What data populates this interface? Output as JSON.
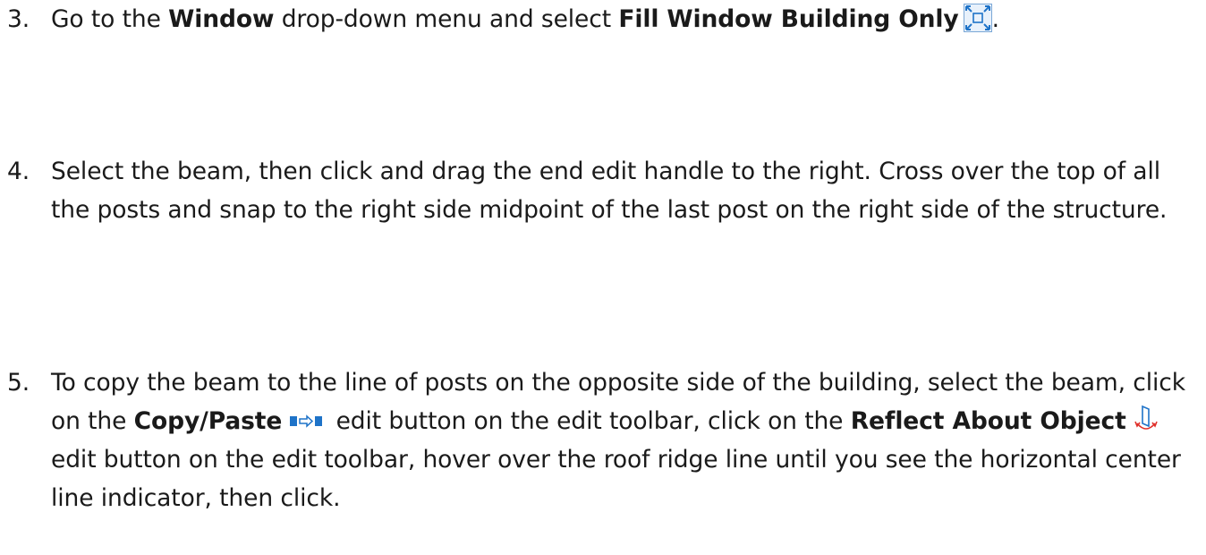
{
  "steps": [
    {
      "number": "3.",
      "parts": {
        "t1": "Go to the ",
        "b1": "Window",
        "t2": " drop-down menu and select ",
        "b2": "Fill Window Building Only",
        "t3": "."
      },
      "icons": [
        "fill-window-building-only-icon"
      ]
    },
    {
      "number": "4.",
      "parts": {
        "t1": "Select the beam, then click and drag the end edit handle to the right. Cross over the top of all the posts and snap to the right side midpoint of the last post on the right side of the structure."
      }
    },
    {
      "number": "5.",
      "parts": {
        "t1": "To copy the beam to the line of posts on the opposite side of the building, select the beam, click on the ",
        "b1": "Copy/Paste",
        "t2": " edit button on the edit toolbar, click on the ",
        "b2": "Reflect About Object",
        "t3": " edit button on the edit toolbar, hover over the roof ridge line until you see the horizontal center line indicator, then click."
      },
      "icons": [
        "copy-paste-icon",
        "reflect-about-object-icon"
      ]
    }
  ],
  "colors": {
    "text": "#1a1a1a",
    "icon_blue": "#1e73c8",
    "icon_bg": "#e8f1fb",
    "icon_border": "#7aa7d6",
    "reflect_arrow": "#e0302a"
  }
}
